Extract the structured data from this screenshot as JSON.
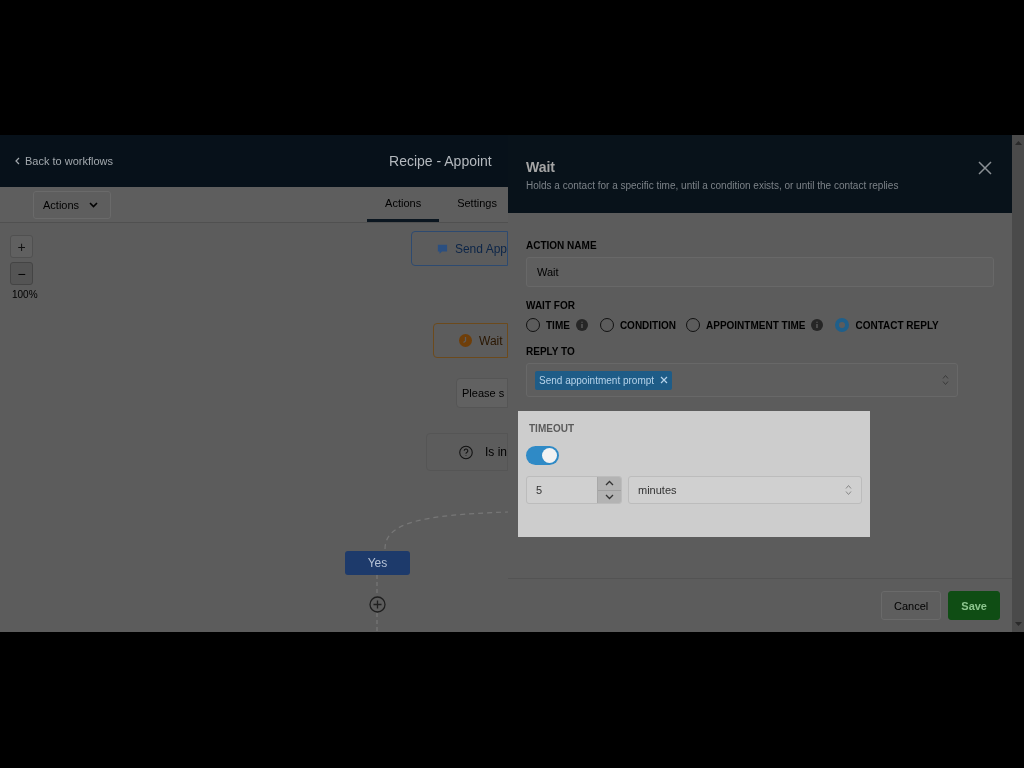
{
  "header": {
    "back_link": "Back to workflows",
    "title": "Recipe - Appoint"
  },
  "toolbar": {
    "actions_dropdown": "Actions",
    "tabs": [
      {
        "label": "Actions",
        "selected": true
      },
      {
        "label": "Settings",
        "selected": false
      }
    ]
  },
  "canvas": {
    "zoom_in": "+",
    "zoom_out": "−",
    "zoom_level": "100%",
    "nodes": [
      {
        "kind": "action",
        "label": "Send App"
      },
      {
        "kind": "wait",
        "label": "Wait"
      },
      {
        "kind": "note",
        "label": "Please s"
      },
      {
        "kind": "condition",
        "label": "Is in"
      },
      {
        "kind": "branch",
        "label": "Yes"
      }
    ]
  },
  "panel": {
    "title": "Wait",
    "subtitle": "Holds a contact for a specific time, until a condition exists, or until the contact replies",
    "action_name": {
      "label": "ACTION NAME",
      "value": "Wait"
    },
    "wait_for": {
      "label": "WAIT FOR",
      "options": [
        {
          "label": "TIME",
          "info": true,
          "selected": false
        },
        {
          "label": "CONDITION",
          "info": false,
          "selected": false
        },
        {
          "label": "APPOINTMENT TIME",
          "info": true,
          "selected": false
        },
        {
          "label": "CONTACT REPLY",
          "info": false,
          "selected": true
        }
      ]
    },
    "reply_to": {
      "label": "REPLY TO",
      "tags": [
        "Send appointment prompt"
      ]
    },
    "timeout": {
      "label": "TIMEOUT",
      "on": true,
      "amount": "5",
      "unit": "minutes"
    },
    "buttons": [
      {
        "label": "Cancel",
        "kind": "secondary"
      },
      {
        "label": "Save",
        "kind": "primary"
      }
    ]
  }
}
